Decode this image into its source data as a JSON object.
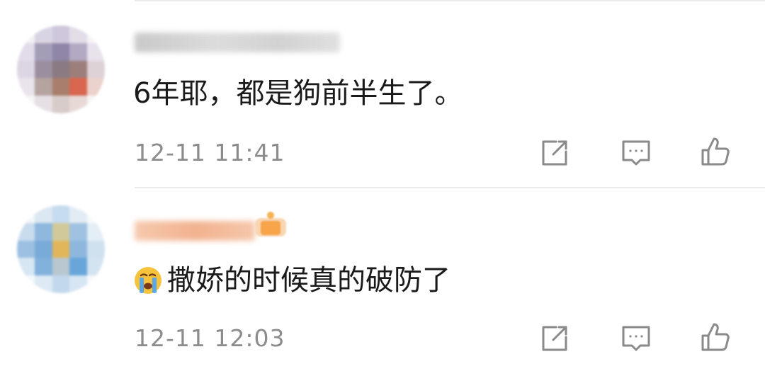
{
  "comments": [
    {
      "text": "6年耶，都是狗前半生了。",
      "time": "12-11 11:41"
    },
    {
      "text": "撒娇的时候真的破防了",
      "time": "12-11 12:03"
    }
  ],
  "icons": {
    "share": "share-icon",
    "comment": "comment-icon",
    "like": "thumbs-up-icon",
    "emoji": "crying-emoji-icon"
  },
  "colors": {
    "text": "#1a1a1a",
    "meta": "#8c8c8c",
    "icon": "#8a8a8a",
    "divider": "#ebebeb"
  }
}
